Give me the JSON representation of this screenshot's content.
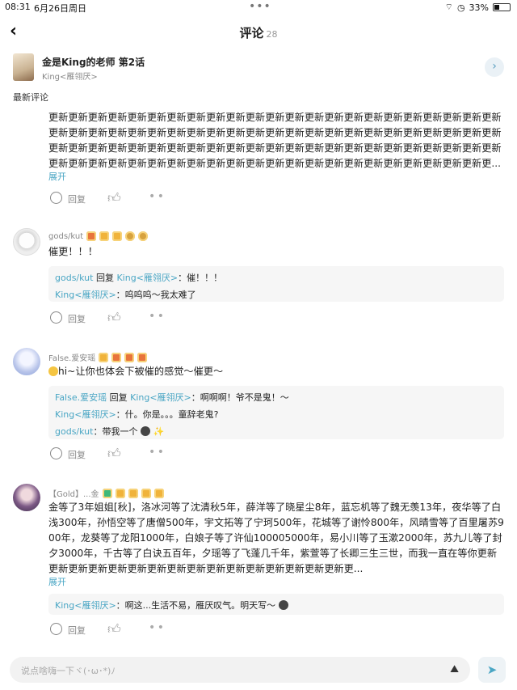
{
  "status_bar": {
    "time": "08:31",
    "date": "6月26日周日",
    "battery": "33%",
    "battery_level": 0.33
  },
  "header": {
    "back_icon": "chevron-left-icon",
    "title": "评论",
    "count": "28"
  },
  "work": {
    "title": "金是King的老师 第2话",
    "author": "King<雁翎厌>"
  },
  "section_title": "最新评论",
  "comments": [
    {
      "text": "更新更新更新更新更新更新更新更新更新更新更新更新更新更新更新更新更新更新更新更新更新更新更新更新更新更新更新更新更新更新更新更新更新更新更新更新更新更新更新更新更新更新更新更新更新更新更新更新更新更新更新更新更新更新更新更新更新更新更新更新更新更新更新更新更新更新更新更新更新更新更新更新更新更新更新更新更新更新更新更新更新更新更新更新更新更新更新更新更新更新更新更...",
      "expand": "展开",
      "reply_label": "回复"
    },
    {
      "user": "gods/kut",
      "text": "催更！！！",
      "replies": [
        {
          "from": "gods/kut",
          "verb": "回复",
          "to": "King<雁翎厌>",
          "text": "：催！！！"
        },
        {
          "from": "King<雁翎厌>",
          "text": "：呜呜呜～我太难了"
        }
      ],
      "reply_label": "回复"
    },
    {
      "user": "False.爱安瑶",
      "text": "hi~让你也体会下被催的感觉～催更～",
      "replies": [
        {
          "from": "False.爱安瑶",
          "verb": "回复",
          "to": "King<雁翎厌>",
          "text": "：啊啊啊！爷不是鬼！～"
        },
        {
          "from": "King<雁翎厌>",
          "text": "：什。你是。。。童辞老鬼?"
        },
        {
          "from": "gods/kut",
          "text": "：带我一个"
        }
      ],
      "reply_label": "回复"
    },
    {
      "user": "【Gold】...金",
      "text": "金等了3年姐姐[秋]，洛冰河等了沈清秋5年，薛洋等了晓星尘8年，蓝忘机等了魏无羡13年，夜华等了白浅300年，孙悟空等了唐僧500年，宇文拓等了宁珂500年，花城等了谢怜800年，风晴雪等了百里屠苏900年，龙葵等了龙阳1000年，白娘子等了许仙100005000年，易小川等了玉漱2000年，苏九儿等了封夕3000年，千古等了白诀五百年，夕瑶等了飞蓬几千年，紫萱等了长卿三生三世，而我一直在等你更新更新更新更新更新更新更新更新更新更新更新更新更新更新更新更新更...",
      "expand": "展开",
      "replies": [
        {
          "from": "King<雁翎厌>",
          "text": "：啊这...生活不易，雁厌叹气。明天写～"
        }
      ],
      "reply_label": "回复"
    }
  ],
  "input": {
    "placeholder": "说点啥嗨一下ヾ(･ω･*)ﾉ"
  },
  "colors": {
    "accent": "#4aa6c4",
    "badge_gold": "#f0b33b"
  }
}
